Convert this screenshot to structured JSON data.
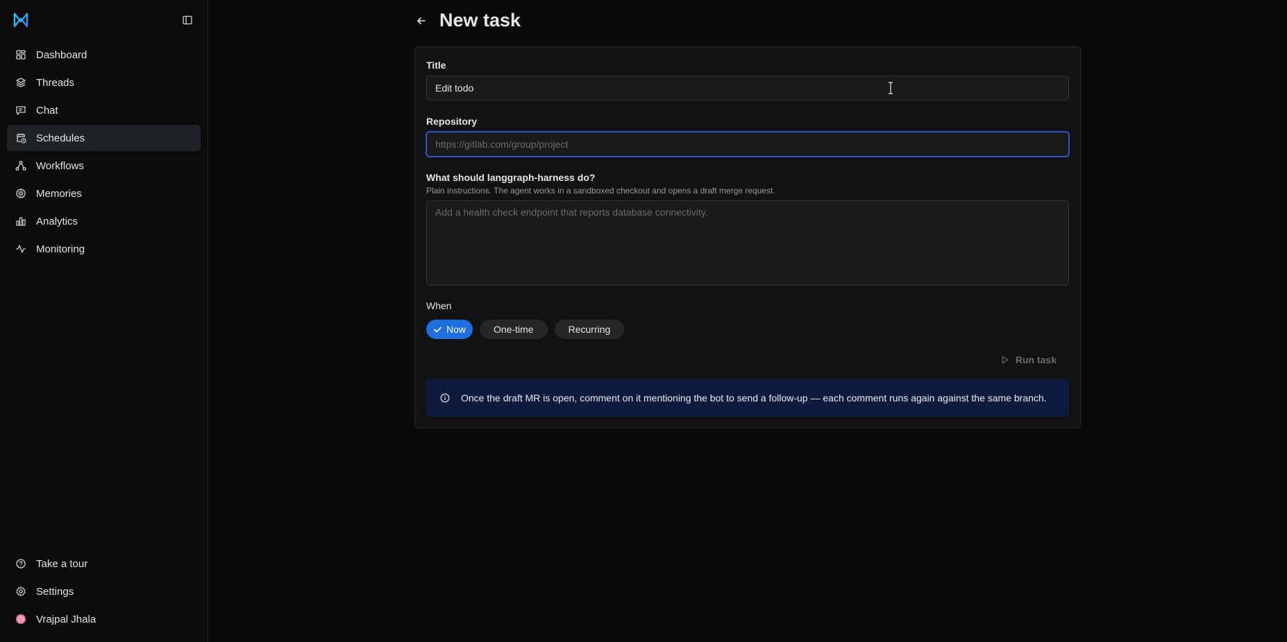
{
  "sidebar": {
    "logo": "app-logo",
    "nav": [
      {
        "label": "Dashboard",
        "icon": "grid-icon"
      },
      {
        "label": "Threads",
        "icon": "layers-icon"
      },
      {
        "label": "Chat",
        "icon": "chat-icon"
      },
      {
        "label": "Schedules",
        "icon": "calendar-clock-icon",
        "active": true
      },
      {
        "label": "Workflows",
        "icon": "workflow-icon"
      },
      {
        "label": "Memories",
        "icon": "brain-icon"
      },
      {
        "label": "Analytics",
        "icon": "bar-chart-icon"
      },
      {
        "label": "Monitoring",
        "icon": "activity-icon"
      }
    ],
    "bottom": [
      {
        "label": "Take a tour",
        "icon": "help-circle-icon"
      },
      {
        "label": "Settings",
        "icon": "gear-icon"
      },
      {
        "label": "Vrajpal Jhala",
        "icon": "avatar"
      }
    ]
  },
  "header": {
    "title": "New task"
  },
  "form": {
    "title_label": "Title",
    "title_value": "Edit todo",
    "repo_label": "Repository",
    "repo_placeholder": "https://gitlab.com/group/project",
    "instructions_label": "What should langgraph-harness do?",
    "instructions_hint": "Plain instructions. The agent works in a sandboxed checkout and opens a draft merge request.",
    "instructions_placeholder": "Add a health check endpoint that reports database connectivity.",
    "when_label": "When",
    "when_options": [
      "Now",
      "One-time",
      "Recurring"
    ],
    "when_selected": "Now",
    "run_label": "Run task"
  },
  "info": {
    "text": "Once the draft MR is open, comment on it mentioning the bot to send a follow-up — each comment runs again against the same branch."
  },
  "colors": {
    "accent": "#1d6fe0",
    "focus_border": "#3b5bdb",
    "info_bg": "#0f1b3d"
  }
}
